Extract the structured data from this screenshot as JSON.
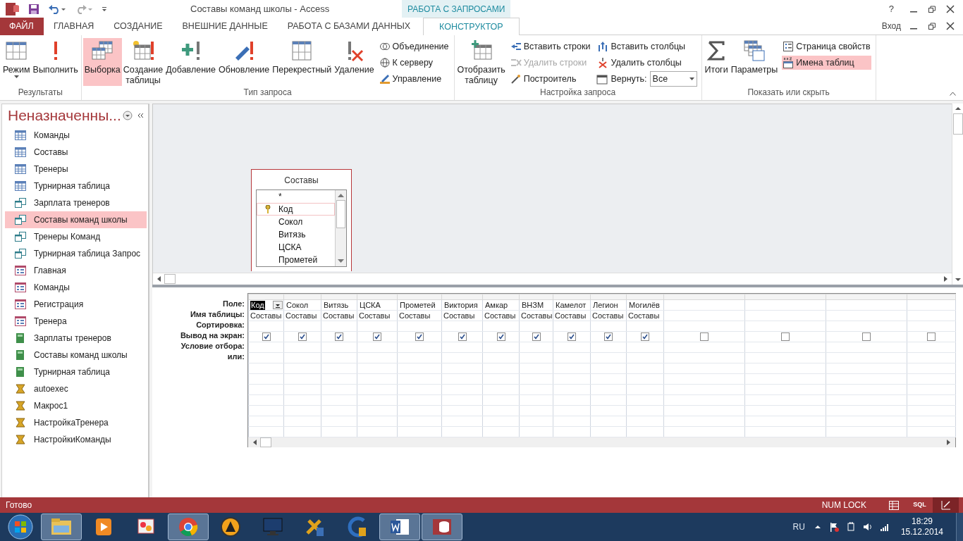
{
  "title_bar": {
    "title": "Составы команд школы - Access",
    "context_tab": "РАБОТА С ЗАПРОСАМИ",
    "help": "?"
  },
  "ribbon_tabs": [
    {
      "label": "ФАЙЛ",
      "kind": "file",
      "selected": false
    },
    {
      "label": "ГЛАВНАЯ",
      "kind": "normal",
      "selected": false
    },
    {
      "label": "СОЗДАНИЕ",
      "kind": "normal",
      "selected": false
    },
    {
      "label": "ВНЕШНИЕ ДАННЫЕ",
      "kind": "normal",
      "selected": false
    },
    {
      "label": "РАБОТА С БАЗАМИ ДАННЫХ",
      "kind": "normal",
      "selected": false
    },
    {
      "label": "КОНСТРУКТОР",
      "kind": "contextual",
      "selected": true
    }
  ],
  "sign_in": "Вход",
  "ribbon_groups": [
    {
      "label": "Результаты",
      "items": [
        {
          "kind": "large",
          "label": "Режим",
          "dropdown": true,
          "selected": false
        },
        {
          "kind": "large",
          "label": "Выполнить",
          "dropdown": false,
          "selected": false
        }
      ]
    },
    {
      "label": "Тип запроса",
      "items": [
        {
          "kind": "large",
          "label": "Выборка",
          "dropdown": false,
          "selected": true
        },
        {
          "kind": "large",
          "label": "Создание\nтаблицы",
          "dropdown": false,
          "selected": false
        },
        {
          "kind": "large",
          "label": "Добавление",
          "dropdown": false,
          "selected": false
        },
        {
          "kind": "large",
          "label": "Обновление",
          "dropdown": false,
          "selected": false
        },
        {
          "kind": "large",
          "label": "Перекрестный",
          "dropdown": false,
          "selected": false
        },
        {
          "kind": "large",
          "label": "Удаление",
          "dropdown": false,
          "selected": false
        },
        {
          "kind": "column",
          "items": [
            {
              "kind": "small",
              "label": "Объединение",
              "disabled": false,
              "selected": false
            },
            {
              "kind": "small",
              "label": "К серверу",
              "disabled": false,
              "selected": false
            },
            {
              "kind": "small",
              "label": "Управление",
              "disabled": false,
              "selected": false
            }
          ]
        }
      ]
    },
    {
      "label": "Настройка запроса",
      "items": [
        {
          "kind": "large",
          "label": "Отобразить\nтаблицу",
          "dropdown": false,
          "selected": false
        },
        {
          "kind": "column",
          "items": [
            {
              "kind": "small",
              "label": "Вставить строки",
              "disabled": false,
              "selected": false
            },
            {
              "kind": "small",
              "label": "Удалить строки",
              "disabled": true,
              "selected": false
            },
            {
              "kind": "small",
              "label": "Построитель",
              "disabled": false,
              "selected": false
            }
          ]
        },
        {
          "kind": "column",
          "items": [
            {
              "kind": "small",
              "label": "Вставить столбцы",
              "disabled": false,
              "selected": false
            },
            {
              "kind": "small",
              "label": "Удалить столбцы",
              "disabled": false,
              "selected": false
            },
            {
              "kind": "combo",
              "label": "Вернуть:",
              "value": "Все"
            }
          ]
        }
      ]
    },
    {
      "label": "Показать или скрыть",
      "items": [
        {
          "kind": "large",
          "label": "Итоги",
          "dropdown": false,
          "selected": false
        },
        {
          "kind": "large",
          "label": "Параметры",
          "dropdown": false,
          "selected": false
        },
        {
          "kind": "column",
          "items": [
            {
              "kind": "small",
              "label": "Страница свойств",
              "disabled": false,
              "selected": false
            },
            {
              "kind": "small",
              "label": "Имена таблиц",
              "disabled": false,
              "selected": true
            }
          ]
        }
      ]
    }
  ],
  "navigation": {
    "title": "Неназначенны...",
    "items": [
      {
        "label": "Команды",
        "kind": "table",
        "selected": false
      },
      {
        "label": "Составы",
        "kind": "table",
        "selected": false
      },
      {
        "label": "Тренеры",
        "kind": "table",
        "selected": false
      },
      {
        "label": "Турнирная таблица",
        "kind": "table",
        "selected": false
      },
      {
        "label": "Зарплата тренеров",
        "kind": "query",
        "selected": false
      },
      {
        "label": "Составы команд школы",
        "kind": "query",
        "selected": true
      },
      {
        "label": "Тренеры Команд",
        "kind": "query",
        "selected": false
      },
      {
        "label": "Турнирная таблица Запрос",
        "kind": "query",
        "selected": false
      },
      {
        "label": "Главная",
        "kind": "form",
        "selected": false
      },
      {
        "label": "Команды",
        "kind": "form",
        "selected": false
      },
      {
        "label": "Регистрация",
        "kind": "form",
        "selected": false
      },
      {
        "label": "Тренера",
        "kind": "form",
        "selected": false
      },
      {
        "label": "Зарплаты тренеров",
        "kind": "report",
        "selected": false
      },
      {
        "label": "Составы команд школы",
        "kind": "report",
        "selected": false
      },
      {
        "label": "Турнирная таблица",
        "kind": "report",
        "selected": false
      },
      {
        "label": "autoexec",
        "kind": "macro",
        "selected": false
      },
      {
        "label": "Макрос1",
        "kind": "macro",
        "selected": false
      },
      {
        "label": "НастройкаТренера",
        "kind": "macro",
        "selected": false
      },
      {
        "label": "НастройкиКоманды",
        "kind": "macro",
        "selected": false
      }
    ]
  },
  "designer": {
    "tables": [
      {
        "title": "Составы",
        "fields": [
          {
            "label": "*",
            "key": false,
            "selected": false
          },
          {
            "label": "Код",
            "key": true,
            "selected": true
          },
          {
            "label": "Сокол",
            "key": false,
            "selected": false
          },
          {
            "label": "Витязь",
            "key": false,
            "selected": false
          },
          {
            "label": "ЦСКА",
            "key": false,
            "selected": false
          },
          {
            "label": "Прометей",
            "key": false,
            "selected": false
          }
        ]
      }
    ]
  },
  "grid": {
    "row_labels": [
      "Поле:",
      "Имя таблицы:",
      "Сортировка:",
      "Вывод на экран:",
      "Условие отбора:",
      "или:"
    ],
    "columns": [
      {
        "field": "Код",
        "table": "Составы",
        "show": true,
        "selected": true
      },
      {
        "field": "Сокол",
        "table": "Составы",
        "show": true,
        "selected": false
      },
      {
        "field": "Витязь",
        "table": "Составы",
        "show": true,
        "selected": false
      },
      {
        "field": "ЦСКА",
        "table": "Составы",
        "show": true,
        "selected": false
      },
      {
        "field": "Прометей",
        "table": "Составы",
        "show": true,
        "selected": false
      },
      {
        "field": "Виктория",
        "table": "Составы",
        "show": true,
        "selected": false
      },
      {
        "field": "Амкар",
        "table": "Составы",
        "show": true,
        "selected": false
      },
      {
        "field": "ВНЗМ",
        "table": "Составы",
        "show": true,
        "selected": false
      },
      {
        "field": "Камелот",
        "table": "Составы",
        "show": true,
        "selected": false
      },
      {
        "field": "Легион",
        "table": "Составы",
        "show": true,
        "selected": false
      },
      {
        "field": "Могилёв",
        "table": "Составы",
        "show": true,
        "selected": false
      },
      {
        "show": false,
        "selected": false
      },
      {
        "show": false,
        "selected": false
      },
      {
        "show": false,
        "selected": false
      },
      {
        "show": false,
        "selected": false
      }
    ]
  },
  "status_bar": {
    "text": "Готово",
    "num_lock": "NUM LOCK",
    "views": [
      {
        "kind": "datasheet",
        "selected": false
      },
      {
        "kind": "sql",
        "label": "SQL",
        "selected": false
      },
      {
        "kind": "design",
        "selected": true
      }
    ]
  },
  "taskbar": {
    "apps": [
      {
        "open": true
      },
      {
        "open": false
      },
      {
        "open": false
      },
      {
        "open": true
      },
      {
        "open": false
      },
      {
        "open": false
      },
      {
        "open": false
      },
      {
        "open": false
      },
      {
        "open": true
      },
      {
        "open": true
      }
    ],
    "language": "RU",
    "time": "18:29",
    "date": "15.12.2014"
  }
}
